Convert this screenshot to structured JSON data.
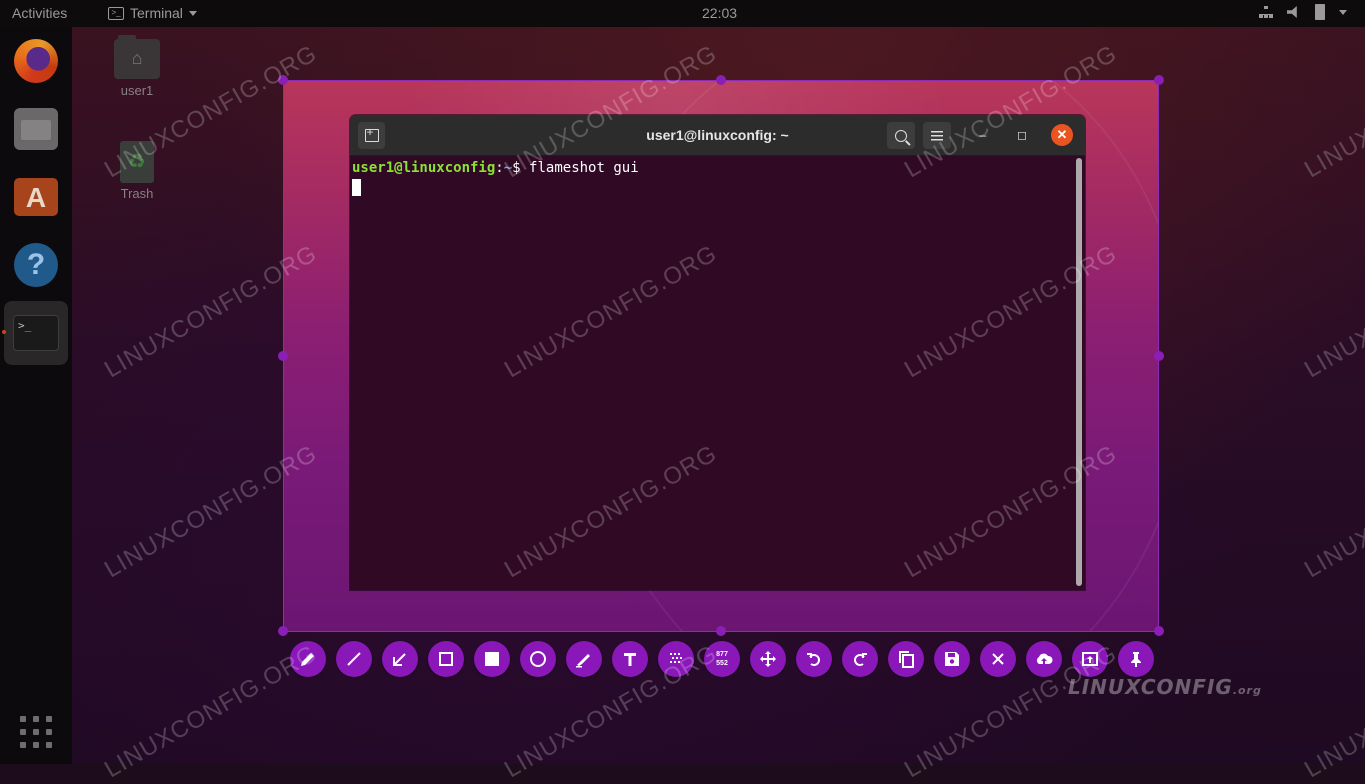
{
  "topbar": {
    "activities": "Activities",
    "app_menu": "Terminal",
    "clock": "22:03"
  },
  "dock": {
    "items": [
      "Firefox",
      "Files",
      "Ubuntu Software",
      "Help",
      "Terminal"
    ],
    "active": "Terminal"
  },
  "desktop": {
    "icons": [
      {
        "label": "user1"
      },
      {
        "label": "Trash"
      }
    ]
  },
  "terminal": {
    "title": "user1@linuxconfig: ~",
    "prompt_user": "user1@linuxconfig",
    "prompt_sep": ":",
    "prompt_path": "~",
    "prompt_symbol": "$",
    "command": "flameshot gui"
  },
  "flameshot": {
    "accent_color": "#8a17b8",
    "selection_size": {
      "width": "877",
      "height": "552"
    },
    "tools": [
      "pencil-icon",
      "line-icon",
      "arrow-icon",
      "rectangle-icon",
      "filled-rectangle-icon",
      "circle-icon",
      "marker-icon",
      "text-icon",
      "pixelate-icon",
      "selection-size-indicator",
      "move-icon",
      "undo-icon",
      "redo-icon",
      "copy-icon",
      "save-icon",
      "exit-icon",
      "upload-icon",
      "open-app-icon",
      "pin-icon"
    ]
  },
  "watermark": {
    "text": "LINUXCONFIG.ORG",
    "logo_main": "LINUXCONFIG",
    "logo_suffix": ".org"
  }
}
